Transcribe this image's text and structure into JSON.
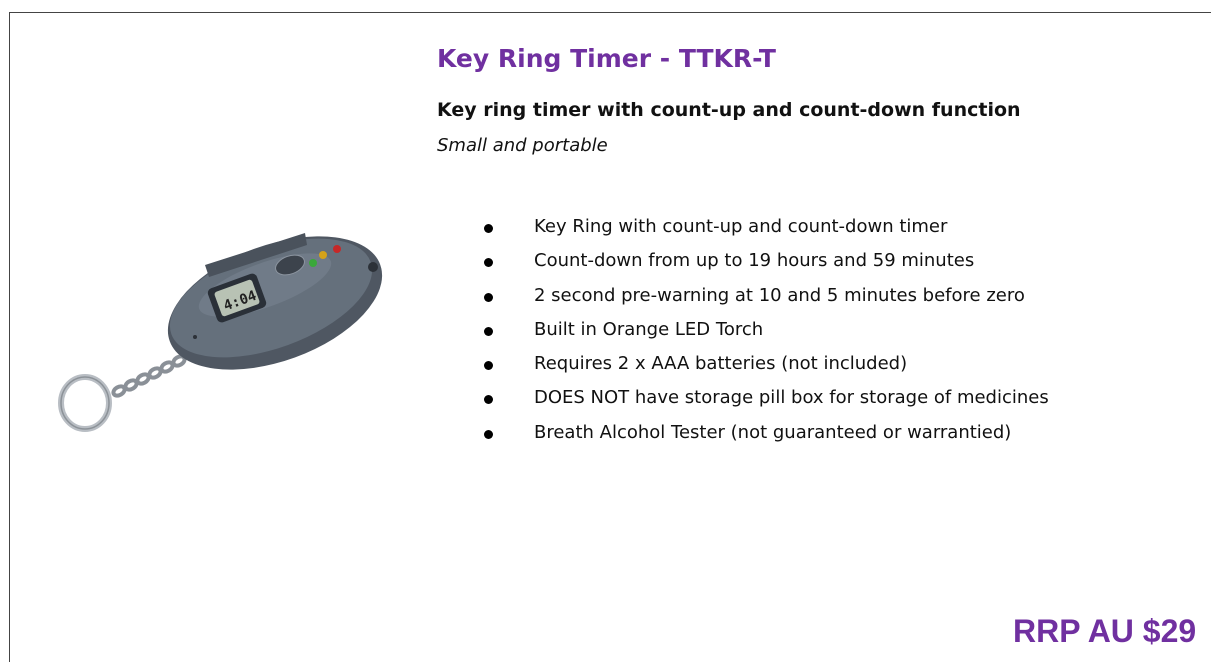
{
  "product": {
    "title": "Key Ring Timer - TTKR-T",
    "subtitle": "Key ring timer with count-up and count-down function",
    "tagline": "Small and portable",
    "display_reading": "4:04",
    "features": [
      "Key Ring with count-up and count-down timer",
      "Count-down from up to 19 hours and 59 minutes",
      "2 second pre-warning at 10 and 5 minutes before zero",
      "Built in Orange LED Torch",
      "Requires 2 x AAA batteries (not included)",
      "DOES NOT have storage pill box for storage of medicines",
      "Breath Alcohol Tester (not guaranteed or warrantied)"
    ],
    "price": "RRP AU $29"
  },
  "colors": {
    "accent": "#7030a0",
    "device_body": "#5b636e"
  }
}
